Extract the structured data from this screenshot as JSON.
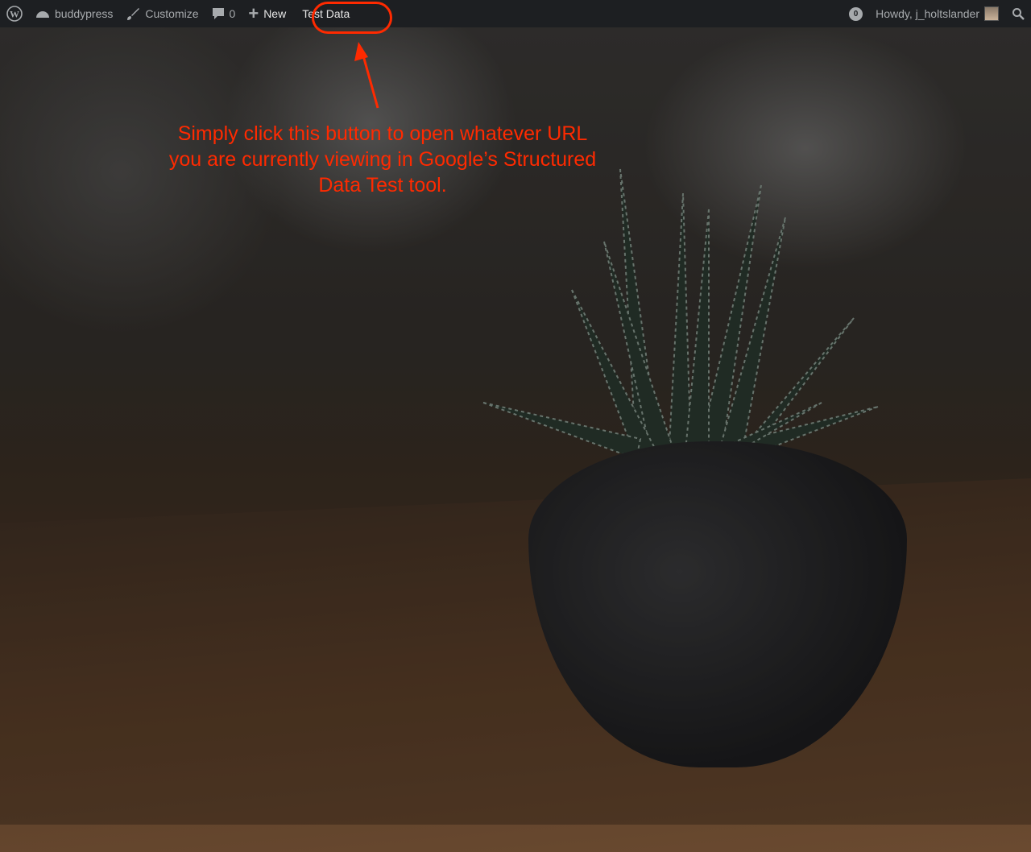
{
  "adminbar": {
    "site_name": "buddypress",
    "customize": "Customize",
    "comments_count": "0",
    "new": "New",
    "test_data": "Test Data",
    "notifications_count": "0",
    "howdy": "Howdy, j_holtslander"
  },
  "annotation": {
    "text": "Simply click this button to open whatever URL you are currently viewing in Google’s Structured Data Test tool.",
    "color": "#ff2a00"
  }
}
